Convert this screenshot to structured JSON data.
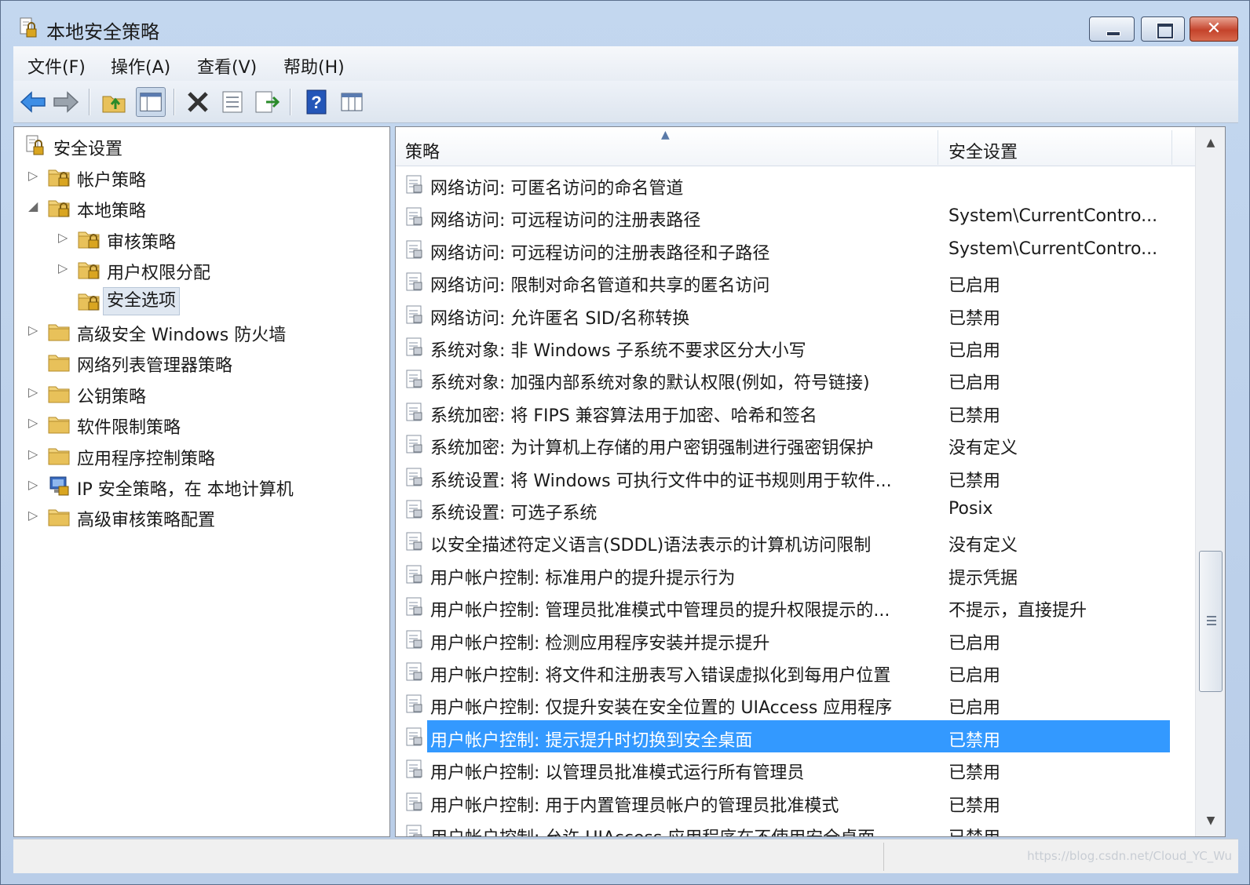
{
  "window": {
    "title": "本地安全策略",
    "buttons": {
      "minimize": "minimize",
      "maximize": "maximize",
      "close": "✕"
    }
  },
  "menu": [
    "文件(F)",
    "操作(A)",
    "查看(V)",
    "帮助(H)"
  ],
  "toolbar": {
    "icons": [
      "back-icon",
      "forward-icon",
      "up-folder-icon",
      "show-hide-tree-icon",
      "delete-icon",
      "properties-icon",
      "export-icon",
      "help-icon",
      "columns-icon"
    ]
  },
  "tree": {
    "root": "安全设置",
    "items": [
      {
        "label": "帐户策略",
        "expand": "▷"
      },
      {
        "label": "本地策略",
        "expand": "◢"
      },
      {
        "label": "审核策略",
        "expand": "▷"
      },
      {
        "label": "用户权限分配",
        "expand": "▷"
      },
      {
        "label": "安全选项",
        "expand": ""
      },
      {
        "label": "高级安全 Windows 防火墙",
        "expand": "▷"
      },
      {
        "label": "网络列表管理器策略",
        "expand": ""
      },
      {
        "label": "公钥策略",
        "expand": "▷"
      },
      {
        "label": "软件限制策略",
        "expand": "▷"
      },
      {
        "label": "应用程序控制策略",
        "expand": "▷"
      },
      {
        "label": "IP 安全策略，在 本地计算机",
        "expand": "▷"
      },
      {
        "label": "高级审核策略配置",
        "expand": "▷"
      }
    ]
  },
  "list": {
    "columns": [
      "策略",
      "安全设置"
    ],
    "sort_indicator": "▲",
    "rows": [
      {
        "policy": "网络访问: 可匿名访问的命名管道",
        "setting": ""
      },
      {
        "policy": "网络访问: 可远程访问的注册表路径",
        "setting": "System\\CurrentContro..."
      },
      {
        "policy": "网络访问: 可远程访问的注册表路径和子路径",
        "setting": "System\\CurrentContro..."
      },
      {
        "policy": "网络访问: 限制对命名管道和共享的匿名访问",
        "setting": "已启用"
      },
      {
        "policy": "网络访问: 允许匿名 SID/名称转换",
        "setting": "已禁用"
      },
      {
        "policy": "系统对象: 非 Windows 子系统不要求区分大小写",
        "setting": "已启用"
      },
      {
        "policy": "系统对象: 加强内部系统对象的默认权限(例如，符号链接)",
        "setting": "已启用"
      },
      {
        "policy": "系统加密: 将 FIPS 兼容算法用于加密、哈希和签名",
        "setting": "已禁用"
      },
      {
        "policy": "系统加密: 为计算机上存储的用户密钥强制进行强密钥保护",
        "setting": "没有定义"
      },
      {
        "policy": "系统设置: 将 Windows 可执行文件中的证书规则用于软件...",
        "setting": "已禁用"
      },
      {
        "policy": "系统设置: 可选子系统",
        "setting": "Posix"
      },
      {
        "policy": "以安全描述符定义语言(SDDL)语法表示的计算机访问限制",
        "setting": "没有定义"
      },
      {
        "policy": "用户帐户控制: 标准用户的提升提示行为",
        "setting": "提示凭据"
      },
      {
        "policy": "用户帐户控制: 管理员批准模式中管理员的提升权限提示的...",
        "setting": "不提示，直接提升"
      },
      {
        "policy": "用户帐户控制: 检测应用程序安装并提示提升",
        "setting": "已启用"
      },
      {
        "policy": "用户帐户控制: 将文件和注册表写入错误虚拟化到每用户位置",
        "setting": "已启用"
      },
      {
        "policy": "用户帐户控制: 仅提升安装在安全位置的 UIAccess 应用程序",
        "setting": "已启用"
      },
      {
        "policy": "用户帐户控制: 提示提升时切换到安全桌面",
        "setting": "已禁用"
      },
      {
        "policy": "用户帐户控制: 以管理员批准模式运行所有管理员",
        "setting": "已禁用"
      },
      {
        "policy": "用户帐户控制: 用于内置管理员帐户的管理员批准模式",
        "setting": "已禁用"
      },
      {
        "policy": "用户帐户控制: 允许 UIAccess 应用程序在不使用安全桌面...",
        "setting": "已禁用"
      }
    ],
    "selected_row": 17
  },
  "statusbar": {
    "watermark": "https://blog.csdn.net/Cloud_YC_Wu"
  },
  "colors": {
    "selection": "#3399ff",
    "frame": "#c3d7ef",
    "folder": "#e8c15a"
  }
}
